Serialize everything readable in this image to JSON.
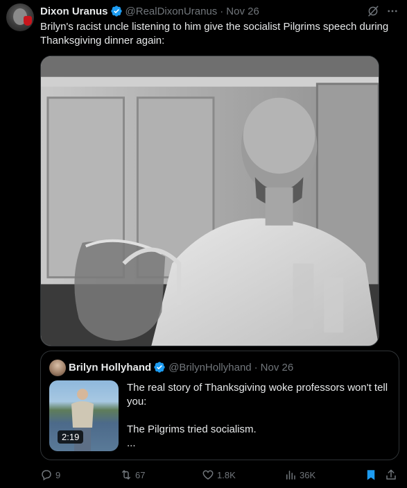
{
  "tweet": {
    "author_name": "Dixon Uranus",
    "author_handle": "@RealDixonUranus",
    "separator": "·",
    "time": "Nov 26",
    "text": "Brilyn's racist uncle listening to him give the socialist Pilgrims speech during Thanksgiving dinner again:"
  },
  "quote": {
    "author_name": "Brilyn Hollyhand",
    "author_handle": "@BrilynHollyhand",
    "separator": "·",
    "time": "Nov 26",
    "video_duration": "2:19",
    "text_line1": "The real story of Thanksgiving woke professors won't tell you:",
    "text_line2": "The Pilgrims tried socialism.",
    "text_line3": "..."
  },
  "actions": {
    "replies": "9",
    "reposts": "67",
    "likes": "1.8K",
    "views": "36K"
  },
  "colors": {
    "background": "#000000",
    "text": "#e7e9ea",
    "muted": "#71767b",
    "verified": "#1d9bf0",
    "bookmark_active": "#1d9bf0",
    "border": "#2f3336"
  },
  "icons": {
    "verified": "verified-badge-icon",
    "grok": "grok-icon",
    "more": "more-icon",
    "reply": "reply-icon",
    "repost": "repost-icon",
    "like": "heart-icon",
    "views": "views-icon",
    "bookmark": "bookmark-icon",
    "share": "share-icon"
  }
}
